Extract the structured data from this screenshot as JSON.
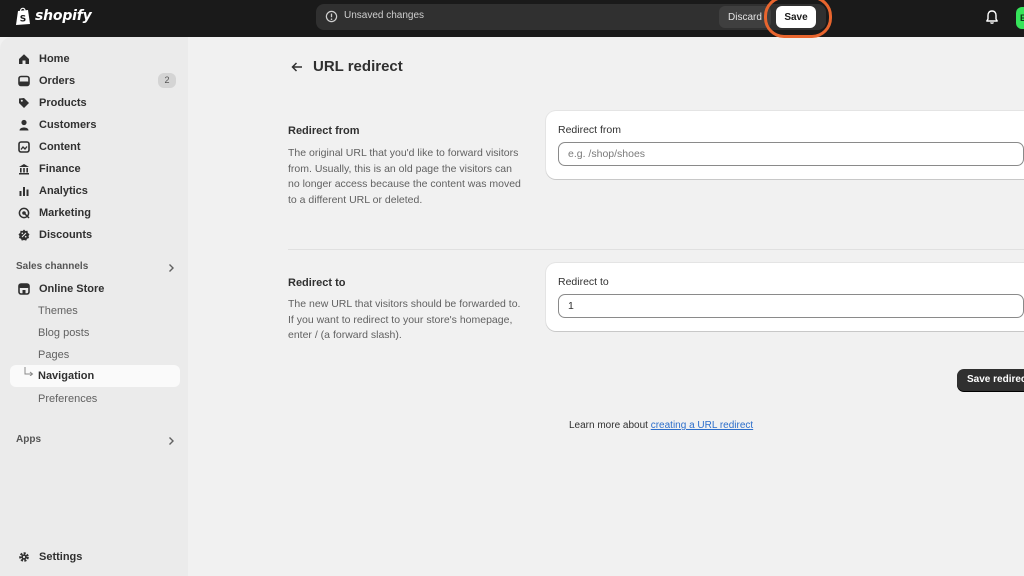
{
  "topbar": {
    "brand": "shopify",
    "unsaved_text": "Unsaved changes",
    "discard_label": "Discard",
    "save_label": "Save",
    "avatar_initial": "E",
    "highlight_color": "#e8652e"
  },
  "sidebar": {
    "items": [
      {
        "label": "Home",
        "icon": "home-icon"
      },
      {
        "label": "Orders",
        "icon": "orders-icon",
        "badge": "2"
      },
      {
        "label": "Products",
        "icon": "tag-icon"
      },
      {
        "label": "Customers",
        "icon": "person-icon"
      },
      {
        "label": "Content",
        "icon": "content-icon"
      },
      {
        "label": "Finance",
        "icon": "bank-icon"
      },
      {
        "label": "Analytics",
        "icon": "bar-chart-icon"
      },
      {
        "label": "Marketing",
        "icon": "target-icon"
      },
      {
        "label": "Discounts",
        "icon": "discount-icon"
      }
    ],
    "sales_channels_label": "Sales channels",
    "online_store_label": "Online Store",
    "online_store_sub": [
      "Themes",
      "Blog posts",
      "Pages",
      "Navigation",
      "Preferences"
    ],
    "apps_label": "Apps",
    "settings_label": "Settings"
  },
  "main": {
    "title": "URL redirect",
    "redirect_from": {
      "section_title": "Redirect from",
      "description": "The original URL that you'd like to forward visitors from. Usually, this is an old page the visitors can no longer access because the content was moved to a different URL or deleted.",
      "field_label": "Redirect from",
      "placeholder": "e.g. /shop/shoes",
      "value": ""
    },
    "redirect_to": {
      "section_title": "Redirect to",
      "description": "The new URL that visitors should be forwarded to. If you want to redirect to your store's homepage, enter / (a forward slash).",
      "field_label": "Redirect to",
      "value": "1"
    },
    "save_redirect_label": "Save redirect",
    "learn_prefix": "Learn more about ",
    "learn_link": "creating a URL redirect"
  }
}
